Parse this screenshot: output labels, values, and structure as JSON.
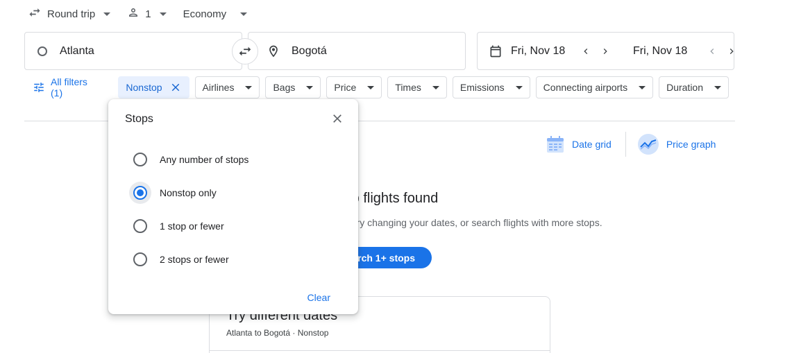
{
  "top": {
    "trip_type": "Round trip",
    "passengers": "1",
    "cabin": "Economy"
  },
  "search": {
    "origin": "Atlanta",
    "destination": "Bogotá",
    "depart_date": "Fri, Nov 18",
    "return_date": "Fri, Nov 18"
  },
  "filters": {
    "all_filters": "All filters (1)",
    "chips": [
      "Nonstop",
      "Airlines",
      "Bags",
      "Price",
      "Times",
      "Emissions",
      "Connecting airports",
      "Duration"
    ]
  },
  "views": {
    "date_grid": "Date grid",
    "price_graph": "Price graph"
  },
  "results": {
    "heading": "top flights found",
    "subtext": ". Try changing your dates, or search flights with more stops.",
    "search_button": "rch 1+ stops"
  },
  "try_dates": {
    "title": "Try different dates",
    "subtitle": "Atlanta to Bogotá · Nonstop"
  },
  "stops_popover": {
    "title": "Stops",
    "options": [
      "Any number of stops",
      "Nonstop only",
      "1 stop or fewer",
      "2 stops or fewer"
    ],
    "selected_index": 1,
    "clear_label": "Clear"
  },
  "colors": {
    "accent": "#1a73e8",
    "chip_active_bg": "#e8f0fe",
    "border": "#dadce0"
  }
}
